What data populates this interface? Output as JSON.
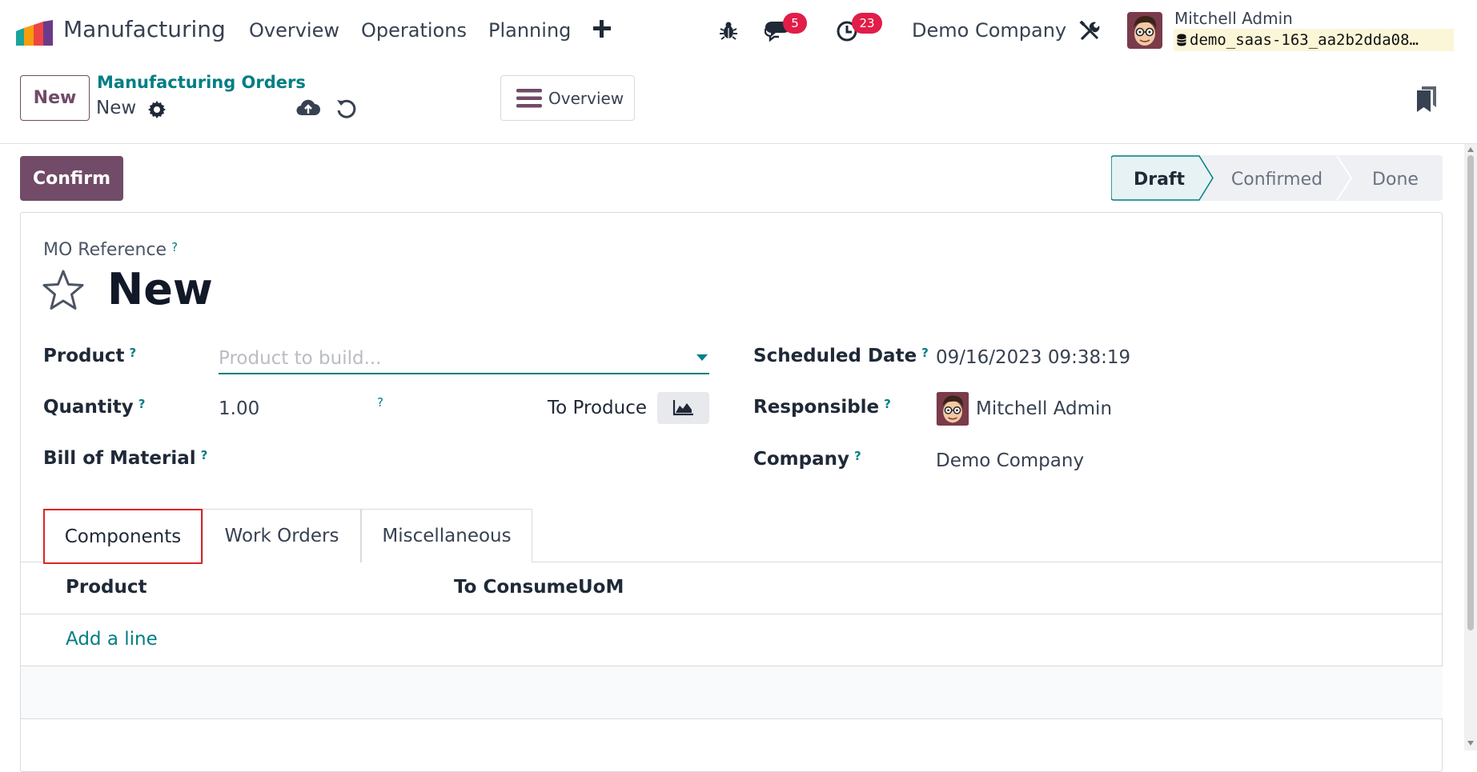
{
  "navbar": {
    "app_name": "Manufacturing",
    "menus": [
      "Overview",
      "Operations",
      "Planning"
    ],
    "messages_count": "5",
    "activities_count": "23",
    "company": "Demo Company",
    "user_name": "Mitchell Admin",
    "database": "demo_saas-163_aa2b2dda08…"
  },
  "control_panel": {
    "new_label": "New",
    "breadcrumb_parent": "Manufacturing Orders",
    "breadcrumb_current": "New",
    "overview_label": "Overview"
  },
  "actions": {
    "confirm_label": "Confirm"
  },
  "statusbar": {
    "stages": [
      "Draft",
      "Confirmed",
      "Done"
    ],
    "active": "Draft"
  },
  "form": {
    "reference_label": "MO Reference",
    "title": "New",
    "help_mark": "?",
    "product_label": "Product",
    "product_placeholder": "Product to build...",
    "quantity_label": "Quantity",
    "quantity_value": "1.00",
    "to_produce_label": "To Produce",
    "bom_label": "Bill of Material",
    "scheduled_label": "Scheduled Date",
    "scheduled_value": "09/16/2023 09:38:19",
    "responsible_label": "Responsible",
    "responsible_value": "Mitchell Admin",
    "company_label": "Company",
    "company_value": "Demo Company"
  },
  "tabs": [
    "Components",
    "Work Orders",
    "Miscellaneous"
  ],
  "components_table": {
    "columns": [
      "Product",
      "To Consume",
      "UoM"
    ],
    "add_line": "Add a line"
  },
  "colors": {
    "primary": "#714b67",
    "link": "#017e84",
    "badge": "#e11d48",
    "db_highlight": "#fbf6d8"
  }
}
